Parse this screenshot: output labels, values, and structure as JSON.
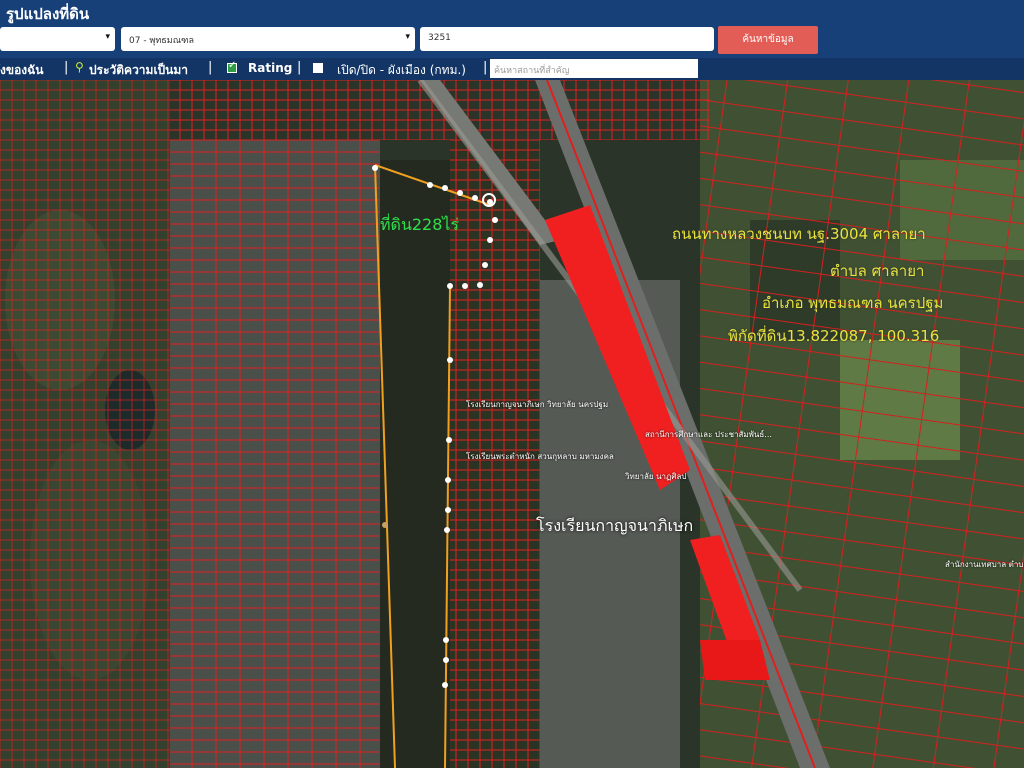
{
  "header": {
    "title": "รูปแปลงที่ดิน",
    "district_select": "07 - พุทธมณฑล",
    "parcel_input": "3251",
    "search_button": "ค้นหาข้อมูล"
  },
  "nav": {
    "item1": "ังของฉัน",
    "item2": "ประวัติความเป็นมา",
    "item3": "Rating",
    "item3_checked": true,
    "item4": "เปิด/ปิด - ผังเมือง (กทม.)",
    "item4_checked": false,
    "poi_search_placeholder": "ค้นหาสถานที่สำคัญ"
  },
  "map": {
    "land_label": "ที่ดิน228ไร่",
    "road_label": "ถนนทางหลวงชนบท นฐ.3004 ศาลายา",
    "subdistrict_label": "ตำบล ศาลายา",
    "district_label": "อำเภอ พุทธมณฑล นครปฐม",
    "coords_label": "พิกัดที่ดิน13.822087, 100.316",
    "school_label": "โรงเรียนกาญจนาภิเษก",
    "pois": [
      "โรงเรียนกาญจนาภิเษก วิทยาลัย นครปฐม",
      "โรงเรียนพระตำหนัก สวนกุหลาบ มหามงคล",
      "สถานีการศึกษาและ ประชาสัมพันธ์...",
      "วิทยาลัย นาฏศิลป",
      "สำนักงานเทศบาล ตำบลศาลายา"
    ]
  },
  "colors": {
    "header": "#173f78",
    "nav": "#123566",
    "button": "#e35d57",
    "parcel": "#e02020",
    "boundary": "#f0a020"
  }
}
